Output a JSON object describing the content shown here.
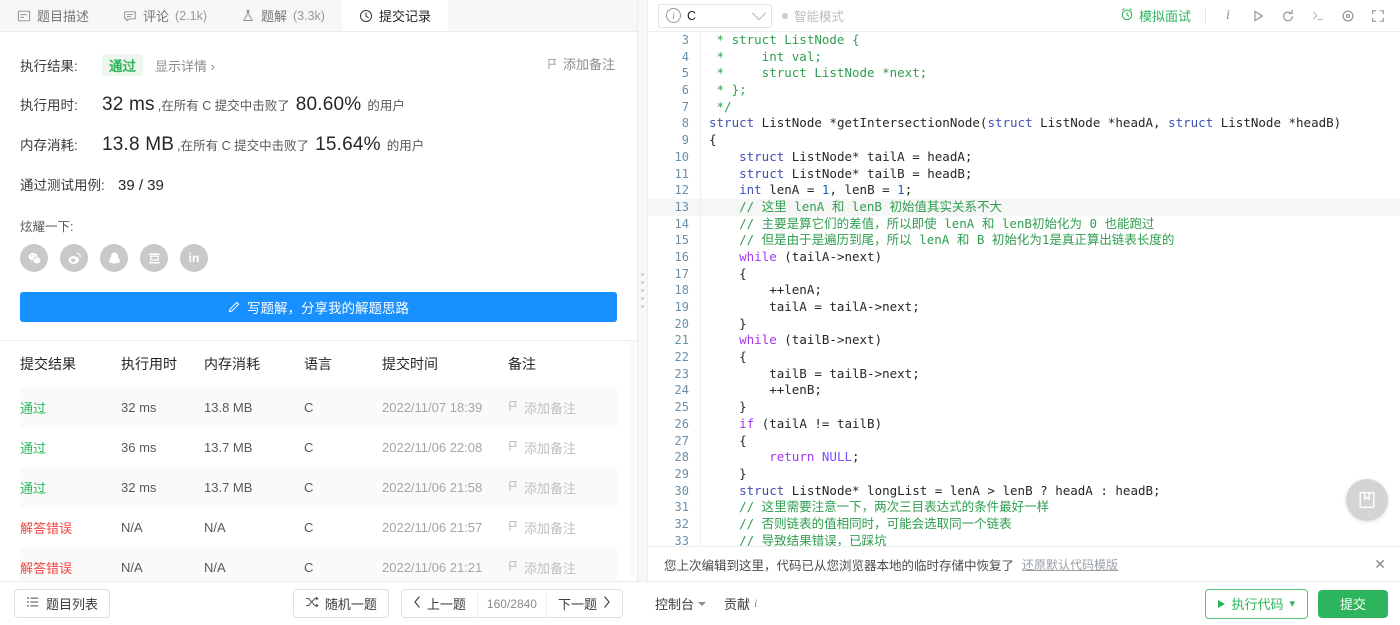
{
  "tabs": [
    {
      "icon": "description-icon",
      "label": "题目描述",
      "count": ""
    },
    {
      "icon": "comment-icon",
      "label": "评论",
      "count": "(2.1k)"
    },
    {
      "icon": "solution-flask-icon",
      "label": "题解",
      "count": "(3.3k)"
    },
    {
      "icon": "clock-icon",
      "label": "提交记录",
      "count": ""
    }
  ],
  "result": {
    "result_label": "执行结果:",
    "result_value": "通过",
    "detail_link": "显示详情 ›",
    "add_note": "添加备注",
    "runtime_label": "执行用时:",
    "runtime_value": "32 ms",
    "runtime_tail_a": ",在所有 C 提交中击败了",
    "runtime_percent": "80.60%",
    "runtime_tail_b": "的用户",
    "memory_label": "内存消耗:",
    "memory_value": "13.8 MB",
    "memory_tail_a": ",在所有 C 提交中击败了",
    "memory_percent": "15.64%",
    "memory_tail_b": "的用户",
    "testcase_label": "通过测试用例:",
    "testcase_value": "39 / 39",
    "share_label": "炫耀一下:",
    "socials": [
      "wechat-icon",
      "weibo-icon",
      "qq-icon",
      "douban-icon",
      "linkedin-icon"
    ],
    "write_solution": "写题解，分享我的解题思路"
  },
  "table": {
    "headers": [
      "提交结果",
      "执行用时",
      "内存消耗",
      "语言",
      "提交时间",
      "备注"
    ],
    "rows": [
      {
        "status": "通过",
        "status_type": "pass",
        "runtime": "32 ms",
        "memory": "13.8 MB",
        "lang": "C",
        "time": "2022/11/07 18:39",
        "note": "添加备注"
      },
      {
        "status": "通过",
        "status_type": "pass",
        "runtime": "36 ms",
        "memory": "13.7 MB",
        "lang": "C",
        "time": "2022/11/06 22:08",
        "note": "添加备注"
      },
      {
        "status": "通过",
        "status_type": "pass",
        "runtime": "32 ms",
        "memory": "13.7 MB",
        "lang": "C",
        "time": "2022/11/06 21:58",
        "note": "添加备注"
      },
      {
        "status": "解答错误",
        "status_type": "fail",
        "runtime": "N/A",
        "memory": "N/A",
        "lang": "C",
        "time": "2022/11/06 21:57",
        "note": "添加备注"
      },
      {
        "status": "解答错误",
        "status_type": "fail",
        "runtime": "N/A",
        "memory": "N/A",
        "lang": "C",
        "time": "2022/11/06 21:21",
        "note": "添加备注"
      }
    ]
  },
  "editor_bar": {
    "language": "C",
    "smart_mode": "智能模式",
    "mock_interview": "模拟面试",
    "icons": [
      "info-icon",
      "play-icon",
      "reset-icon",
      "terminal-icon",
      "settings-icon",
      "fullscreen-icon"
    ]
  },
  "code": {
    "first_line_number": 3,
    "highlight_line": 13,
    "lines": [
      [
        {
          "t": " * struct ListNode {",
          "c": "cm"
        }
      ],
      [
        {
          "t": " *     int val;",
          "c": "cm"
        }
      ],
      [
        {
          "t": " *     struct ListNode *next;",
          "c": "cm"
        }
      ],
      [
        {
          "t": " * };",
          "c": "cm"
        }
      ],
      [
        {
          "t": " */",
          "c": "cm"
        }
      ],
      [
        {
          "t": "struct",
          "c": "ty"
        },
        {
          "t": " ListNode *getIntersectionNode(",
          "c": "pn"
        },
        {
          "t": "struct",
          "c": "ty"
        },
        {
          "t": " ListNode *headA, ",
          "c": "pn"
        },
        {
          "t": "struct",
          "c": "ty"
        },
        {
          "t": " ListNode *headB)",
          "c": "pn"
        }
      ],
      [
        {
          "t": "{",
          "c": "pn"
        }
      ],
      [
        {
          "t": "    ",
          "c": "pn"
        },
        {
          "t": "struct",
          "c": "ty"
        },
        {
          "t": " ListNode* tailA = headA;",
          "c": "pn"
        }
      ],
      [
        {
          "t": "    ",
          "c": "pn"
        },
        {
          "t": "struct",
          "c": "ty"
        },
        {
          "t": " ListNode* tailB = headB;",
          "c": "pn"
        }
      ],
      [
        {
          "t": "    ",
          "c": "pn"
        },
        {
          "t": "int",
          "c": "ty"
        },
        {
          "t": " lenA = ",
          "c": "pn"
        },
        {
          "t": "1",
          "c": "nm"
        },
        {
          "t": ", lenB = ",
          "c": "pn"
        },
        {
          "t": "1",
          "c": "nm"
        },
        {
          "t": ";",
          "c": "pn"
        }
      ],
      [
        {
          "t": "    // 这里 lenA 和 lenB 初始值其实关系不大",
          "c": "cm"
        }
      ],
      [
        {
          "t": "    // 主要是算它们的差值，所以即使 lenA 和 lenB初始化为 0 也能跑过",
          "c": "cm"
        }
      ],
      [
        {
          "t": "    // 但是由于是遍历到尾，所以 lenA 和 B 初始化为1是真正算出链表长度的",
          "c": "cm"
        }
      ],
      [
        {
          "t": "    ",
          "c": "pn"
        },
        {
          "t": "while",
          "c": "kw"
        },
        {
          "t": " (tailA->next)",
          "c": "pn"
        }
      ],
      [
        {
          "t": "    {",
          "c": "pn"
        }
      ],
      [
        {
          "t": "        ++lenA;",
          "c": "pn"
        }
      ],
      [
        {
          "t": "        tailA = tailA->next;",
          "c": "pn"
        }
      ],
      [
        {
          "t": "    }",
          "c": "pn"
        }
      ],
      [
        {
          "t": "    ",
          "c": "pn"
        },
        {
          "t": "while",
          "c": "kw"
        },
        {
          "t": " (tailB->next)",
          "c": "pn"
        }
      ],
      [
        {
          "t": "    {",
          "c": "pn"
        }
      ],
      [
        {
          "t": "        tailB = tailB->next;",
          "c": "pn"
        }
      ],
      [
        {
          "t": "        ++lenB;",
          "c": "pn"
        }
      ],
      [
        {
          "t": "    }",
          "c": "pn"
        }
      ],
      [
        {
          "t": "    ",
          "c": "pn"
        },
        {
          "t": "if",
          "c": "kw"
        },
        {
          "t": " (tailA != tailB)",
          "c": "pn"
        }
      ],
      [
        {
          "t": "    {",
          "c": "pn"
        }
      ],
      [
        {
          "t": "        ",
          "c": "pn"
        },
        {
          "t": "return",
          "c": "kw"
        },
        {
          "t": " ",
          "c": "pn"
        },
        {
          "t": "NULL",
          "c": "kw2"
        },
        {
          "t": ";",
          "c": "pn"
        }
      ],
      [
        {
          "t": "    }",
          "c": "pn"
        }
      ],
      [
        {
          "t": "    ",
          "c": "pn"
        },
        {
          "t": "struct",
          "c": "ty"
        },
        {
          "t": " ListNode* longList = lenA > lenB ? headA : headB;",
          "c": "pn"
        }
      ],
      [
        {
          "t": "    // 这里需要注意一下，两次三目表达式的条件最好一样",
          "c": "cm"
        }
      ],
      [
        {
          "t": "    // 否则链表的值相同时，可能会选取同一个链表",
          "c": "cm"
        }
      ],
      [
        {
          "t": "    // 导致结果错误，已踩坑",
          "c": "cm"
        }
      ]
    ]
  },
  "notice": {
    "text": "您上次编辑到这里，代码已从您浏览器本地的临时存储中恢复了",
    "link": "还原默认代码模版",
    "close": "✕"
  },
  "fab": {
    "icon": "book-icon"
  },
  "bottom": {
    "problem_list": "题目列表",
    "random": "随机一题",
    "prev": "上一题",
    "counter": "160/2840",
    "next": "下一题",
    "console": "控制台",
    "contribute": "贡献",
    "run_code": "执行代码",
    "submit": "提交"
  },
  "colors": {
    "pass": "#2db55d",
    "fail": "#ef4743",
    "primary_blue": "#1890ff",
    "submit_green": "#2db55d"
  }
}
